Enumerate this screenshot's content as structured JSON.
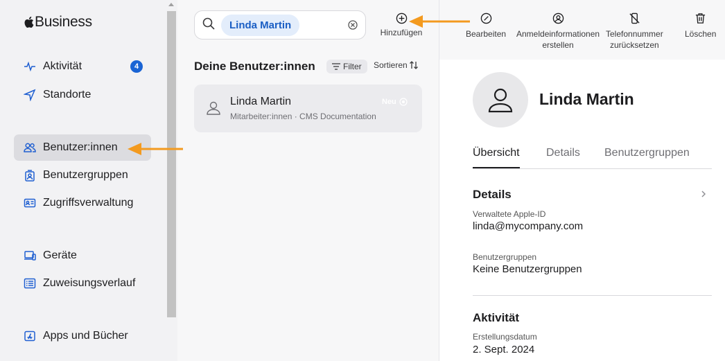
{
  "app": {
    "logo_text": "Business"
  },
  "sidebar": {
    "items": [
      {
        "label": "Aktivität",
        "icon": "activity-icon",
        "badge": "4"
      },
      {
        "label": "Standorte",
        "icon": "location-arrow-icon"
      },
      {
        "label": "Benutzer:innen",
        "icon": "users-icon",
        "active": true
      },
      {
        "label": "Benutzergruppen",
        "icon": "user-group-icon"
      },
      {
        "label": "Zugriffsverwaltung",
        "icon": "id-card-icon"
      },
      {
        "label": "Geräte",
        "icon": "devices-icon"
      },
      {
        "label": "Zuweisungsverlauf",
        "icon": "list-icon"
      },
      {
        "label": "Apps und Bücher",
        "icon": "app-store-icon"
      }
    ]
  },
  "search": {
    "token": "Linda Martin"
  },
  "list": {
    "add_label": "Hinzufügen",
    "title": "Deine Benutzer:innen",
    "filter_label": "Filter",
    "sort_label": "Sortieren",
    "users": [
      {
        "name": "Linda Martin",
        "subtitle": "Mitarbeiter:innen · CMS Documentation",
        "tag": "Neu"
      }
    ]
  },
  "toolbar": {
    "edit": "Bearbeiten",
    "credentials_line1": "Anmeldeinformationen",
    "credentials_line2": "erstellen",
    "phone_line1": "Telefonnummer",
    "phone_line2": "zurücksetzen",
    "delete": "Löschen"
  },
  "detail": {
    "name": "Linda Martin",
    "tabs": [
      "Übersicht",
      "Details",
      "Benutzergruppen"
    ],
    "details_title": "Details",
    "apple_id_label": "Verwaltete Apple-ID",
    "apple_id_value": "linda@mycompany.com",
    "groups_label": "Benutzergruppen",
    "groups_value": "Keine Benutzergruppen",
    "activity_title": "Aktivität",
    "created_label": "Erstellungsdatum",
    "created_value": "2. Sept. 2024"
  },
  "colors": {
    "accent": "#1a64d4",
    "annotation_arrow": "#f39a1f"
  }
}
